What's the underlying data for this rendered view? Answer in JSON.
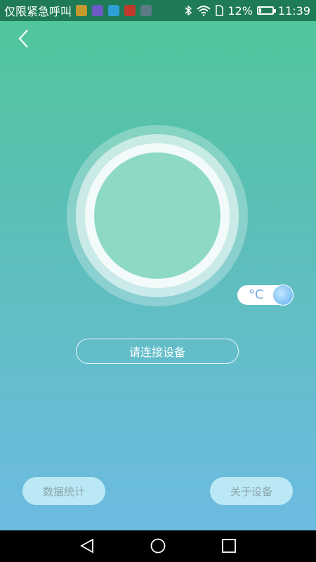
{
  "status_bar": {
    "carrier": "仅限紧急呼叫",
    "notification_icons": [
      {
        "name": "app1-icon",
        "color": "#c49a2c"
      },
      {
        "name": "app2-icon",
        "color": "#6c5bc4"
      },
      {
        "name": "app3-icon",
        "color": "#2f9fd8"
      },
      {
        "name": "music-icon",
        "color": "#c0392b"
      },
      {
        "name": "app5-icon",
        "color": "#5b7a85"
      }
    ],
    "battery_percent": "12%",
    "time": "11:39"
  },
  "unit_toggle": {
    "label": "°C"
  },
  "connect_button": {
    "label": "请连接设备"
  },
  "bottom_buttons": {
    "stats_label": "数据统计",
    "about_label": "关于设备"
  },
  "colors": {
    "gradient_top": "#4fc79a",
    "gradient_bottom": "#6dbbe2",
    "status_bar": "#1f7b55"
  }
}
